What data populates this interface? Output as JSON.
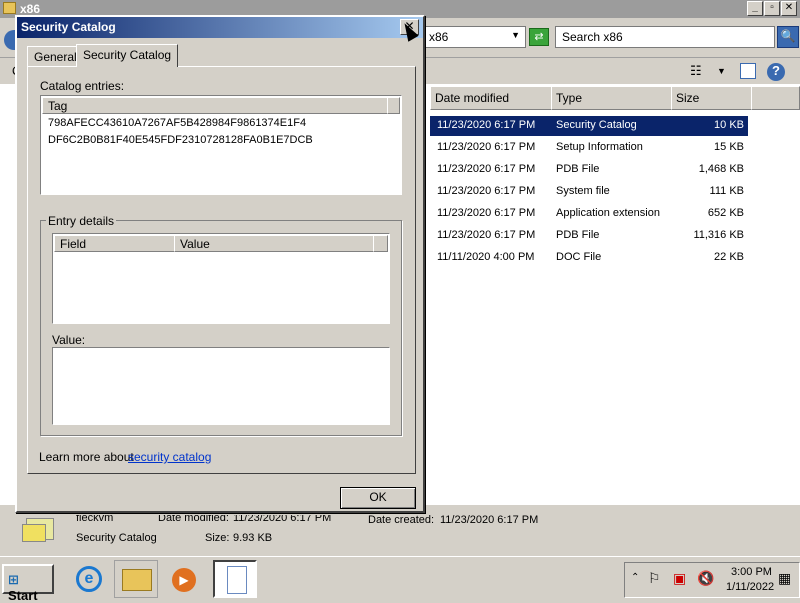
{
  "explorer": {
    "window_title": "x86",
    "path_text": "x86",
    "search_placeholder": "Search x86",
    "left_partial_letter": "C",
    "columns": {
      "date_modified": "Date modified",
      "type": "Type",
      "size": "Size"
    },
    "rows": [
      {
        "date": "11/23/2020 6:17 PM",
        "type": "Security Catalog",
        "size": "10 KB",
        "selected": true
      },
      {
        "date": "11/23/2020 6:17 PM",
        "type": "Setup Information",
        "size": "15 KB"
      },
      {
        "date": "11/23/2020 6:17 PM",
        "type": "PDB File",
        "size": "1,468 KB"
      },
      {
        "date": "11/23/2020 6:17 PM",
        "type": "System file",
        "size": "111 KB"
      },
      {
        "date": "11/23/2020 6:17 PM",
        "type": "Application extension",
        "size": "652 KB"
      },
      {
        "date": "11/23/2020 6:17 PM",
        "type": "PDB File",
        "size": "11,316 KB"
      },
      {
        "date": "11/11/2020 4:00 PM",
        "type": "DOC File",
        "size": "22 KB"
      }
    ],
    "details": {
      "name": "fieckvm",
      "date_modified_label": "Date modified:",
      "date_modified_value": "11/23/2020 6:17 PM",
      "date_created_label": "Date created:",
      "date_created_value": "11/23/2020 6:17 PM",
      "type": "Security Catalog",
      "size_label": "Size:",
      "size_value": "9.93 KB"
    }
  },
  "dialog": {
    "title": "Security Catalog",
    "tabs": [
      "General",
      "Security Catalog"
    ],
    "catalog_entries_label": "Catalog entries:",
    "tag_header": "Tag",
    "entries": [
      "798AFECC43610A7267AF5B428984F9861374E1F4",
      "DF6C2B0B81F40E545FDF2310728128FA0B1E7DCB"
    ],
    "entry_details_label": "Entry details",
    "field_header": "Field",
    "value_header": "Value",
    "value_label": "Value:",
    "learn_more_text": "Learn more about ",
    "learn_more_link": "security catalog",
    "ok_label": "OK"
  },
  "taskbar": {
    "start_label": "Start",
    "time": "3:00 PM",
    "date": "1/11/2022"
  }
}
